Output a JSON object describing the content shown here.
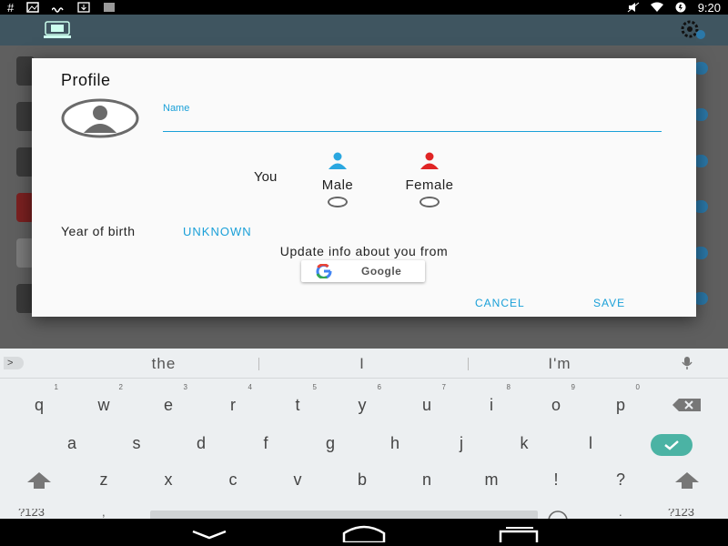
{
  "status_bar": {
    "left_icons": [
      "hash-icon",
      "image-icon",
      "wave-icon",
      "download-icon",
      "barcode-icon"
    ],
    "hash_glyph": "#",
    "right_icons": [
      "mute-icon",
      "wifi-icon",
      "battery-icon"
    ],
    "time": "9:20"
  },
  "dialog": {
    "title": "Profile",
    "name_label": "Name",
    "name_value": "",
    "gender_label": "You",
    "male_label": "Male",
    "female_label": "Female",
    "year_label": "Year of birth",
    "year_value": "UNKNOWN",
    "update_text": "Update info about you from",
    "google_label": "Google",
    "cancel_label": "CANCEL",
    "save_label": "SAVE",
    "colors": {
      "accent": "#1aa0d8",
      "male": "#2aa7e0",
      "female": "#e02424"
    }
  },
  "keyboard": {
    "suggestions": [
      "the",
      "I",
      "I'm"
    ],
    "expand_glyph": ">",
    "row1": [
      {
        "k": "q",
        "n": "1"
      },
      {
        "k": "w",
        "n": "2"
      },
      {
        "k": "e",
        "n": "3"
      },
      {
        "k": "r",
        "n": "4"
      },
      {
        "k": "t",
        "n": "5"
      },
      {
        "k": "y",
        "n": "6"
      },
      {
        "k": "u",
        "n": "7"
      },
      {
        "k": "i",
        "n": "8"
      },
      {
        "k": "o",
        "n": "9"
      },
      {
        "k": "p",
        "n": "0"
      }
    ],
    "row2": [
      "a",
      "s",
      "d",
      "f",
      "g",
      "h",
      "j",
      "k",
      "l"
    ],
    "row3": [
      "z",
      "x",
      "c",
      "v",
      "b",
      "n",
      "m",
      "!",
      "?"
    ],
    "symbols_label": "?123",
    "comma": ",",
    "period": ".",
    "enter_color": "#4bb3a4"
  }
}
